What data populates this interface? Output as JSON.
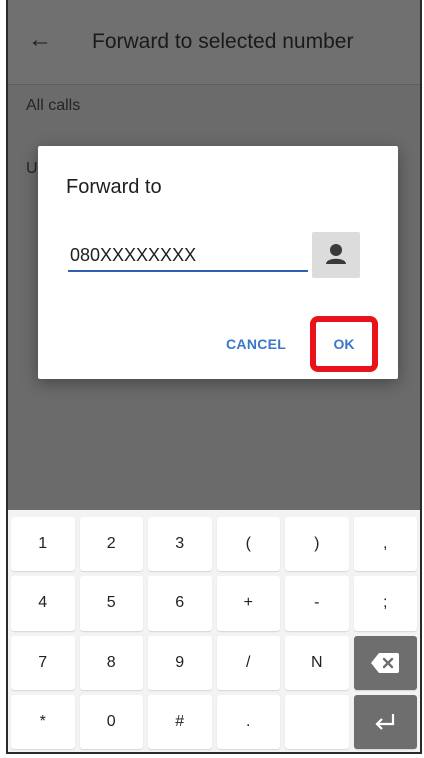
{
  "app_bar": {
    "title": "Forward to selected number",
    "back_icon": "arrow-left-icon"
  },
  "settings": {
    "row1": "All calls",
    "row2_partial": "U"
  },
  "dialog": {
    "title": "Forward to",
    "input_value": "080XXXXXXXX",
    "contact_icon": "person-icon",
    "cancel_label": "CANCEL",
    "ok_label": "OK",
    "highlight_color": "#e8131b"
  },
  "keyboard": {
    "rows": [
      [
        "1",
        "2",
        "3",
        "(",
        ")",
        ","
      ],
      [
        "4",
        "5",
        "6",
        "+",
        "-",
        ";"
      ],
      [
        "7",
        "8",
        "9",
        "/",
        "N",
        "backspace"
      ],
      [
        "*",
        "0",
        "#",
        ".",
        "",
        "enter"
      ]
    ]
  }
}
